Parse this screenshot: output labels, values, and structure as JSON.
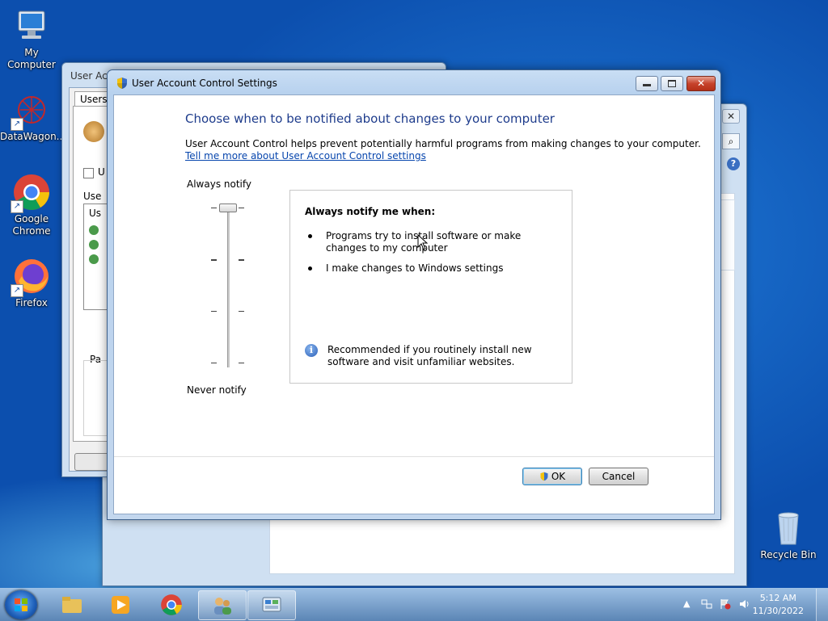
{
  "desktop": {
    "icons": [
      {
        "label": "My Computer"
      },
      {
        "label": "DataWagon..."
      },
      {
        "label": "Google\nChrome"
      },
      {
        "label": "Firefox"
      },
      {
        "label": "Recycle Bin"
      }
    ]
  },
  "background_window": {
    "title": "User Acc",
    "tab": "Users",
    "checkbox_label": "U",
    "section_label": "Use",
    "list_header": "Us",
    "group_label": "Pa"
  },
  "dialog": {
    "title": "User Account Control Settings",
    "heading": "Choose when to be notified about changes to your computer",
    "description": "User Account Control helps prevent potentially harmful programs from making changes to your computer.",
    "link": "Tell me more about User Account Control settings",
    "slider": {
      "top_label": "Always notify",
      "bottom_label": "Never notify",
      "level": 1.0
    },
    "info": {
      "title": "Always notify me when:",
      "bullets": [
        "Programs try to install software or make changes to my computer",
        "I make changes to Windows settings"
      ],
      "recommendation": "Recommended if you routinely install new software and visit unfamiliar websites."
    },
    "ok_label": "OK",
    "cancel_label": "Cancel"
  },
  "taskbar": {
    "items": [
      "start",
      "windows-explorer",
      "media-player",
      "google-chrome",
      "user-accounts",
      "control-panel"
    ],
    "clock_time": "5:12 AM",
    "clock_date": "11/30/2022"
  },
  "colors": {
    "heading": "#1e3c8c",
    "link": "#0645ad",
    "desktop": "#0c4fae"
  }
}
